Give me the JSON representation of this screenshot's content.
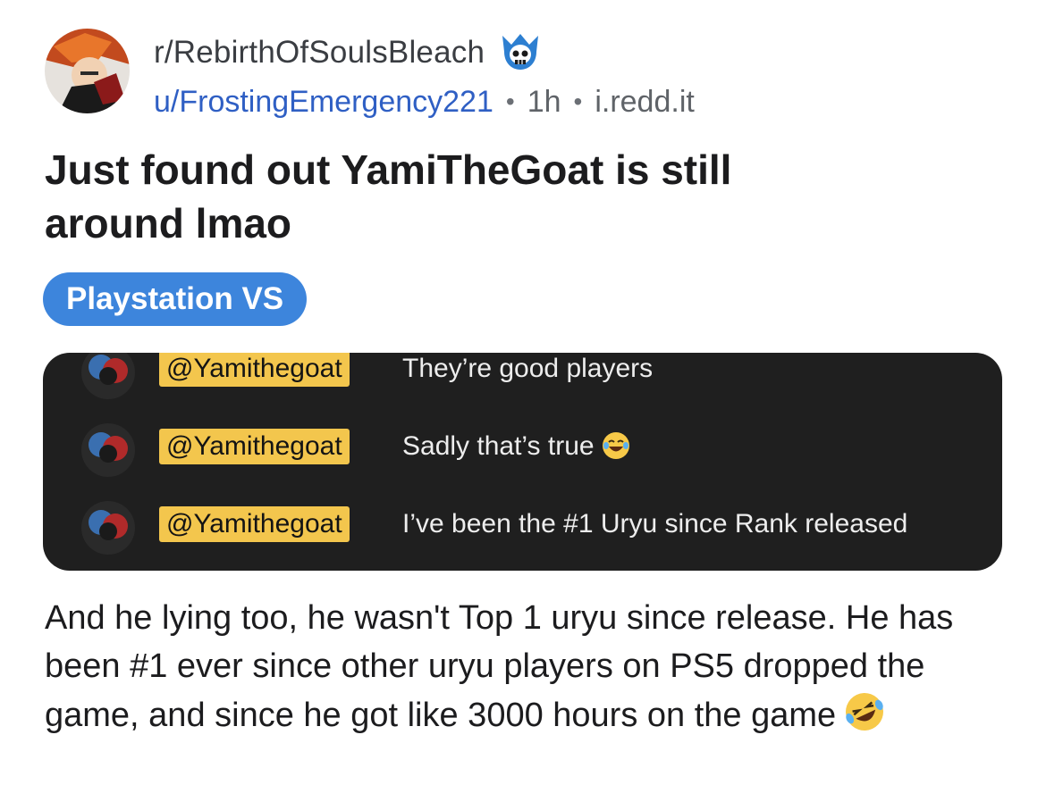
{
  "post": {
    "subreddit": "r/RebirthOfSoulsBleach",
    "subreddit_icon": "skull-icon",
    "author": "u/FrostingEmergency221",
    "separator": "•",
    "age": "1h",
    "domain": "i.redd.it",
    "title": "Just found out YamiTheGoat is still around lmao",
    "flair": "Playstation VS",
    "body": "And he lying too, he wasn't Top 1 uryu since release. He has been #1 ever since other uryu players on PS5 dropped the game, and since he got like 3000 hours on the game",
    "body_emoji": "rofl-emoji-icon"
  },
  "screenshot": {
    "messages": [
      {
        "tag": "@Yamithegoat",
        "text": "They’re good players"
      },
      {
        "tag": "@Yamithegoat",
        "text": "Sadly that’s true",
        "emoji": "laughing-emoji-icon"
      },
      {
        "tag": "@Yamithegoat",
        "text": "I’ve been the #1 Uryu since Rank released"
      }
    ]
  },
  "colors": {
    "flair_bg": "#3d85dc",
    "author_link": "#2f5fc4",
    "card_bg": "#1f1f1f",
    "tag_bg": "#f3c64d"
  }
}
